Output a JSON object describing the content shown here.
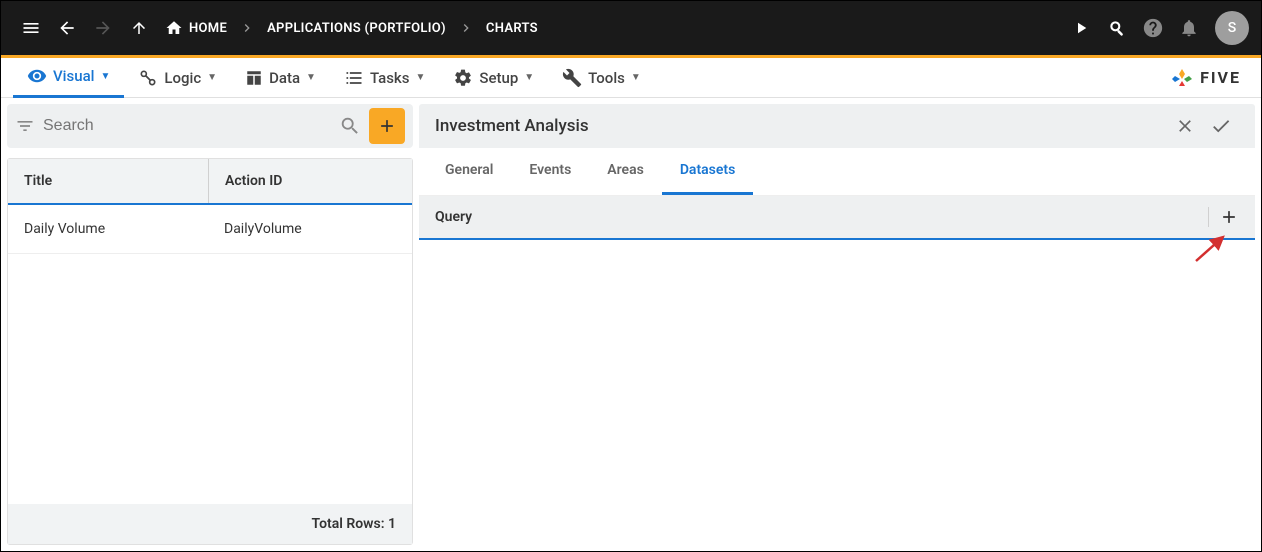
{
  "topbar": {
    "breadcrumbs": [
      {
        "label": "HOME"
      },
      {
        "label": "APPLICATIONS (PORTFOLIO)"
      },
      {
        "label": "CHARTS"
      }
    ],
    "avatar_initial": "S"
  },
  "subnav": {
    "items": [
      {
        "label": "Visual",
        "active": true
      },
      {
        "label": "Logic"
      },
      {
        "label": "Data"
      },
      {
        "label": "Tasks"
      },
      {
        "label": "Setup"
      },
      {
        "label": "Tools"
      }
    ],
    "brand": "FIVE"
  },
  "left": {
    "search_placeholder": "Search",
    "columns": {
      "title": "Title",
      "action_id": "Action ID"
    },
    "rows": [
      {
        "title": "Daily Volume",
        "action_id": "DailyVolume"
      }
    ],
    "footer_label": "Total Rows:",
    "footer_count": "1"
  },
  "panel": {
    "title": "Investment Analysis",
    "tabs": [
      {
        "label": "General"
      },
      {
        "label": "Events"
      },
      {
        "label": "Areas"
      },
      {
        "label": "Datasets",
        "active": true
      }
    ],
    "section_title": "Query"
  }
}
